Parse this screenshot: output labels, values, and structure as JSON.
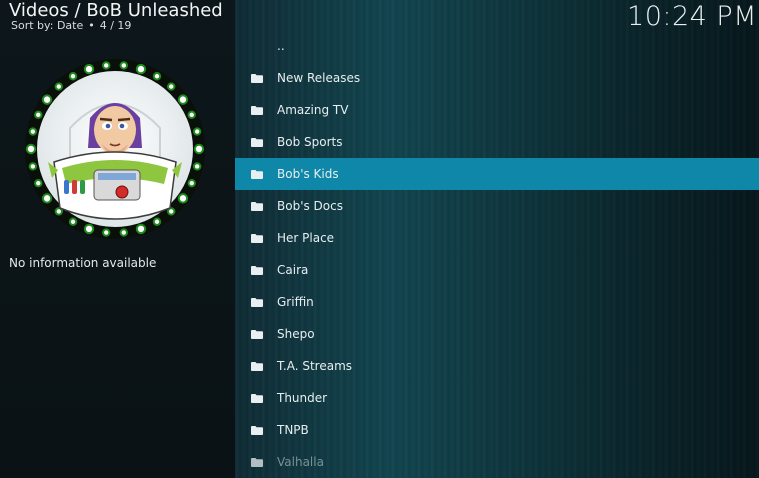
{
  "header": {
    "title": "Videos / BoB Unleashed",
    "sort_label": "Sort by: Date",
    "separator": "•",
    "position": "4 / 19"
  },
  "clock": "10:24 PM",
  "info_text": "No information available",
  "thumbnail_icon": "buzz-lightyear-addon-icon",
  "list": {
    "parent_label": "..",
    "items": [
      {
        "label": "New Releases",
        "icon": "folder-icon"
      },
      {
        "label": "Amazing TV",
        "icon": "folder-icon"
      },
      {
        "label": "Bob Sports",
        "icon": "folder-icon"
      },
      {
        "label": "Bob's Kids",
        "icon": "folder-icon",
        "selected": true
      },
      {
        "label": "Bob's Docs",
        "icon": "folder-icon"
      },
      {
        "label": "Her Place",
        "icon": "folder-icon"
      },
      {
        "label": "Caira",
        "icon": "folder-icon"
      },
      {
        "label": "Griffin",
        "icon": "folder-icon"
      },
      {
        "label": "Shepo",
        "icon": "folder-icon"
      },
      {
        "label": "T.A. Streams",
        "icon": "folder-icon"
      },
      {
        "label": "Thunder",
        "icon": "folder-icon"
      },
      {
        "label": "TNPB",
        "icon": "folder-icon"
      },
      {
        "label": "Valhalla",
        "icon": "folder-icon"
      }
    ]
  },
  "colors": {
    "selection": "#0e87a8",
    "left_panel": "#0d161a",
    "list_background": "#124a55"
  }
}
